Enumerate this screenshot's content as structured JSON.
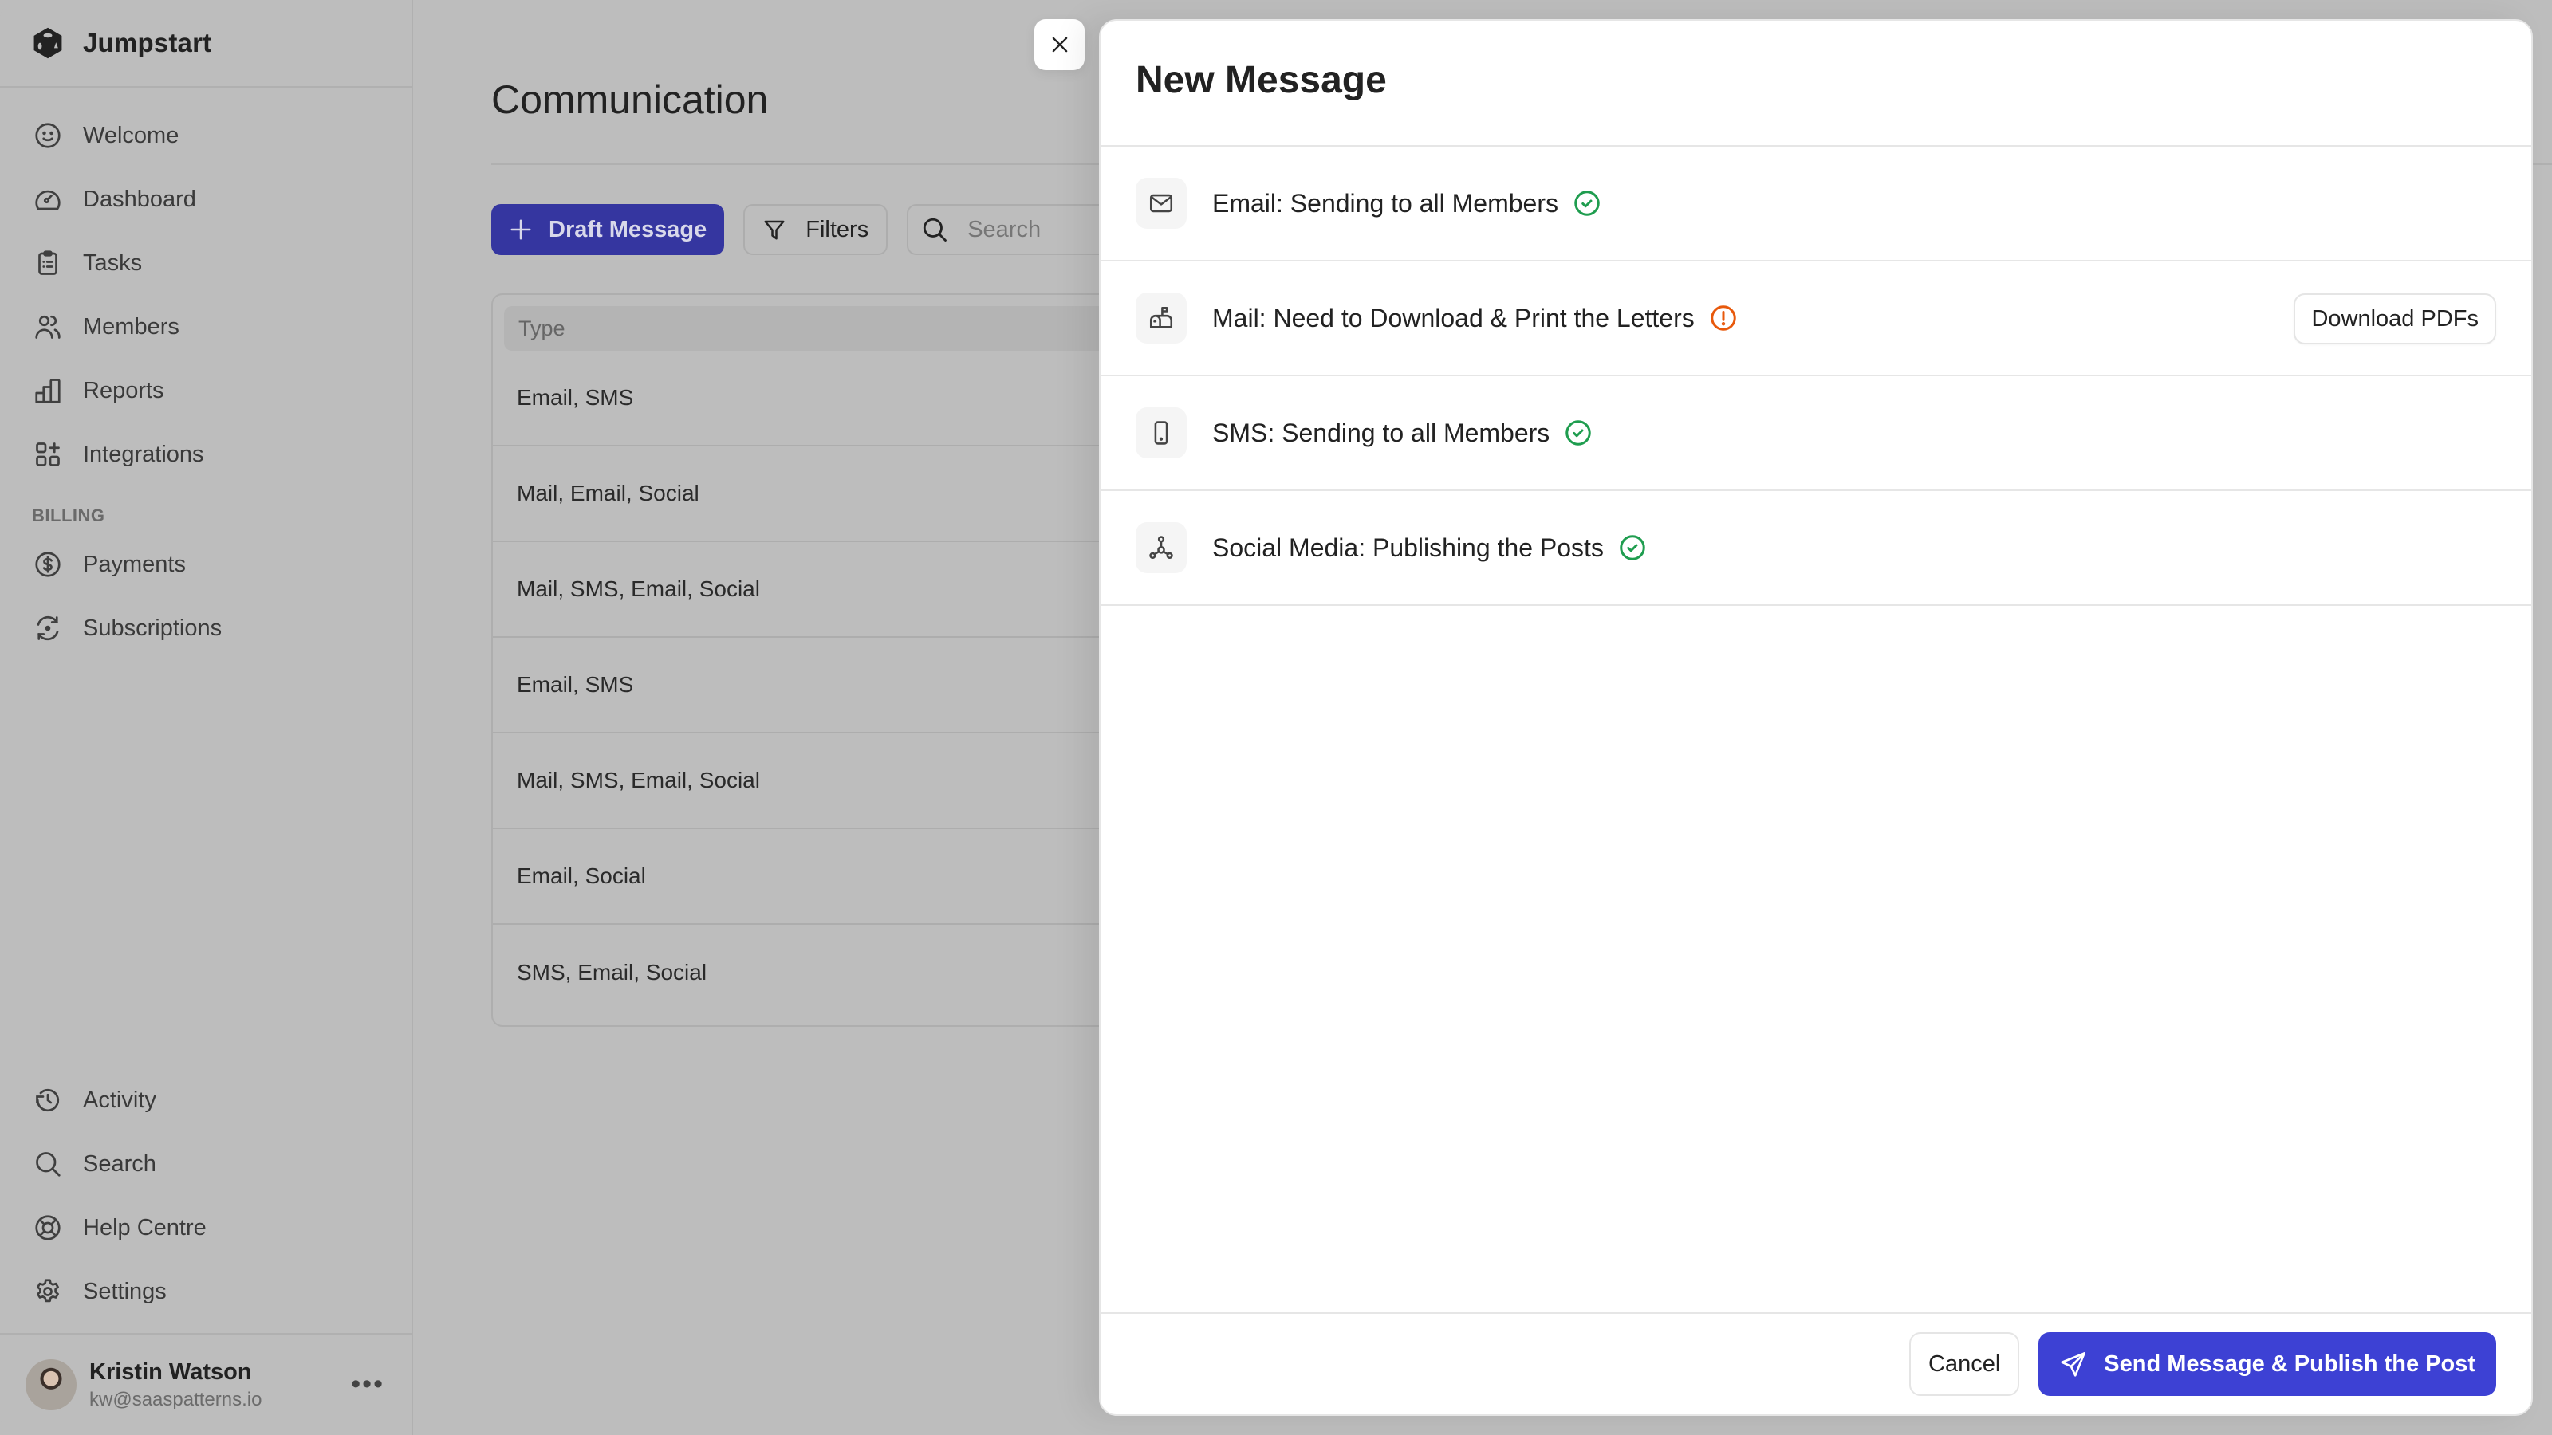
{
  "app": {
    "name": "Jumpstart"
  },
  "sidebar": {
    "primary": [
      {
        "label": "Welcome",
        "icon": "smile-icon"
      },
      {
        "label": "Dashboard",
        "icon": "gauge-icon"
      },
      {
        "label": "Tasks",
        "icon": "clipboard-list-icon"
      },
      {
        "label": "Members",
        "icon": "users-icon"
      },
      {
        "label": "Reports",
        "icon": "bar-chart-icon"
      },
      {
        "label": "Integrations",
        "icon": "apps-plus-icon"
      }
    ],
    "billing_label": "BILLING",
    "billing": [
      {
        "label": "Payments",
        "icon": "dollar-circle-icon"
      },
      {
        "label": "Subscriptions",
        "icon": "refresh-cycle-icon"
      }
    ],
    "bottom": [
      {
        "label": "Activity",
        "icon": "history-icon"
      },
      {
        "label": "Search",
        "icon": "search-icon"
      },
      {
        "label": "Help Centre",
        "icon": "lifebuoy-icon"
      },
      {
        "label": "Settings",
        "icon": "gear-icon"
      }
    ],
    "user": {
      "name": "Kristin Watson",
      "email": "kw@saaspatterns.io",
      "more": "•••"
    }
  },
  "main": {
    "title": "Communication",
    "toolbar": {
      "draft_label": "Draft Message",
      "filters_label": "Filters",
      "search_placeholder": "Search"
    },
    "table": {
      "columns": [
        "Type"
      ],
      "rows": [
        "Email, SMS",
        "Mail, Email, Social",
        "Mail, SMS, Email, Social",
        "Email, SMS",
        "Mail, SMS, Email, Social",
        "Email, Social",
        "SMS, Email, Social"
      ]
    }
  },
  "modal": {
    "title": "New Message",
    "channels": [
      {
        "icon": "envelope-icon",
        "text": "Email: Sending to all Members",
        "status": "success"
      },
      {
        "icon": "mailbox-icon",
        "text": "Mail: Need to Download & Print the Letters",
        "status": "warning",
        "action_label": "Download PDFs"
      },
      {
        "icon": "mobile-phone-icon",
        "text": "SMS: Sending to all Members",
        "status": "success"
      },
      {
        "icon": "share-network-icon",
        "text": "Social Media: Publishing the Posts",
        "status": "success"
      }
    ],
    "footer": {
      "cancel_label": "Cancel",
      "send_label": "Send Message & Publish the Post"
    }
  },
  "colors": {
    "primary": "#3d41d4",
    "success": "#1f9d4f",
    "warning": "#e8590c",
    "overlay": "#bdbdbd"
  }
}
